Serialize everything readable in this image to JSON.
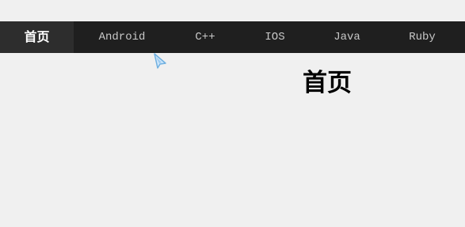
{
  "nav": {
    "items": [
      {
        "label": "首页",
        "active": true
      },
      {
        "label": "Android",
        "active": false
      },
      {
        "label": "C++",
        "active": false
      },
      {
        "label": "IOS",
        "active": false
      },
      {
        "label": "Java",
        "active": false
      },
      {
        "label": "Ruby",
        "active": false
      }
    ]
  },
  "main": {
    "heading": "首页"
  },
  "colors": {
    "nav_background": "#1f1f1f",
    "nav_active_background": "#2d2d2d",
    "nav_text": "#c8c8c8",
    "nav_active_text": "#ffffff",
    "page_background": "#f0f0f0",
    "cursor": "#7fb8e6"
  },
  "icons": {
    "cursor": "mouse-pointer-icon"
  }
}
